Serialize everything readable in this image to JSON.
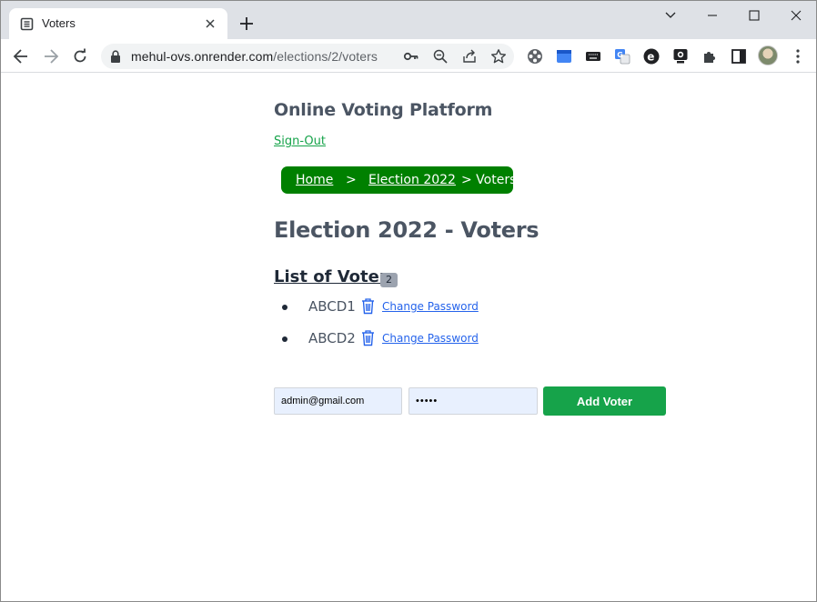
{
  "browser": {
    "tab_title": "Voters",
    "url_host": "mehul-ovs.onrender.com",
    "url_path": "/elections/2/voters"
  },
  "app": {
    "title": "Online Voting Platform",
    "signout_label": "Sign-Out"
  },
  "breadcrumb": {
    "home": "Home",
    "sep1": ">",
    "election": "Election 2022",
    "current": "> Voters"
  },
  "page": {
    "heading": "Election 2022 - Voters",
    "list_heading": "List of Voters",
    "voter_count": "2"
  },
  "voters": [
    {
      "name": "ABCD1",
      "action": "Change Password"
    },
    {
      "name": "ABCD2",
      "action": "Change Password"
    }
  ],
  "form": {
    "email_value": "admin@gmail.com",
    "password_value": "•••••",
    "submit_label": "Add Voter"
  },
  "colors": {
    "breadcrumb_bg": "#008000",
    "primary_green": "#16a34a",
    "link_blue": "#2563eb"
  }
}
